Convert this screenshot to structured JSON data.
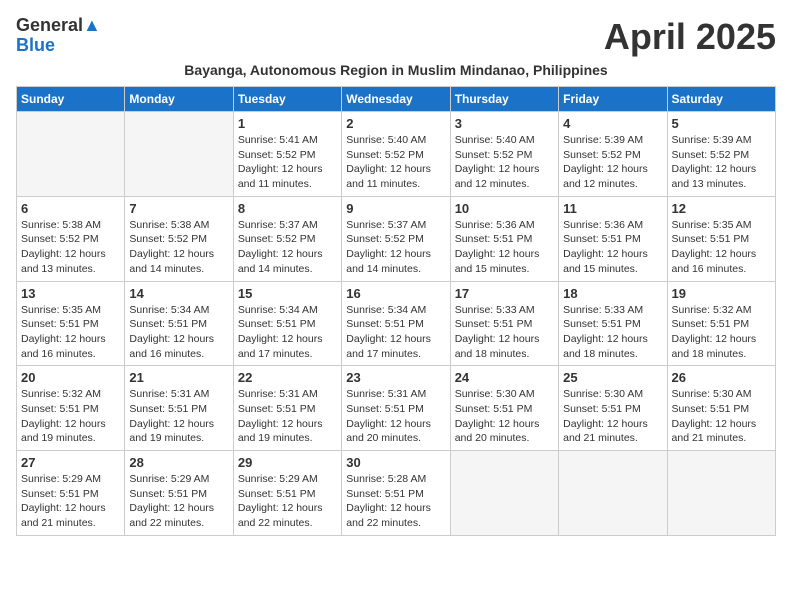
{
  "header": {
    "logo_line1": "General",
    "logo_line2": "Blue",
    "month_title": "April 2025",
    "subtitle": "Bayanga, Autonomous Region in Muslim Mindanao, Philippines"
  },
  "days_of_week": [
    "Sunday",
    "Monday",
    "Tuesday",
    "Wednesday",
    "Thursday",
    "Friday",
    "Saturday"
  ],
  "weeks": [
    [
      {
        "day": "",
        "info": ""
      },
      {
        "day": "",
        "info": ""
      },
      {
        "day": "1",
        "info": "Sunrise: 5:41 AM\nSunset: 5:52 PM\nDaylight: 12 hours and 11 minutes."
      },
      {
        "day": "2",
        "info": "Sunrise: 5:40 AM\nSunset: 5:52 PM\nDaylight: 12 hours and 11 minutes."
      },
      {
        "day": "3",
        "info": "Sunrise: 5:40 AM\nSunset: 5:52 PM\nDaylight: 12 hours and 12 minutes."
      },
      {
        "day": "4",
        "info": "Sunrise: 5:39 AM\nSunset: 5:52 PM\nDaylight: 12 hours and 12 minutes."
      },
      {
        "day": "5",
        "info": "Sunrise: 5:39 AM\nSunset: 5:52 PM\nDaylight: 12 hours and 13 minutes."
      }
    ],
    [
      {
        "day": "6",
        "info": "Sunrise: 5:38 AM\nSunset: 5:52 PM\nDaylight: 12 hours and 13 minutes."
      },
      {
        "day": "7",
        "info": "Sunrise: 5:38 AM\nSunset: 5:52 PM\nDaylight: 12 hours and 14 minutes."
      },
      {
        "day": "8",
        "info": "Sunrise: 5:37 AM\nSunset: 5:52 PM\nDaylight: 12 hours and 14 minutes."
      },
      {
        "day": "9",
        "info": "Sunrise: 5:37 AM\nSunset: 5:52 PM\nDaylight: 12 hours and 14 minutes."
      },
      {
        "day": "10",
        "info": "Sunrise: 5:36 AM\nSunset: 5:51 PM\nDaylight: 12 hours and 15 minutes."
      },
      {
        "day": "11",
        "info": "Sunrise: 5:36 AM\nSunset: 5:51 PM\nDaylight: 12 hours and 15 minutes."
      },
      {
        "day": "12",
        "info": "Sunrise: 5:35 AM\nSunset: 5:51 PM\nDaylight: 12 hours and 16 minutes."
      }
    ],
    [
      {
        "day": "13",
        "info": "Sunrise: 5:35 AM\nSunset: 5:51 PM\nDaylight: 12 hours and 16 minutes."
      },
      {
        "day": "14",
        "info": "Sunrise: 5:34 AM\nSunset: 5:51 PM\nDaylight: 12 hours and 16 minutes."
      },
      {
        "day": "15",
        "info": "Sunrise: 5:34 AM\nSunset: 5:51 PM\nDaylight: 12 hours and 17 minutes."
      },
      {
        "day": "16",
        "info": "Sunrise: 5:34 AM\nSunset: 5:51 PM\nDaylight: 12 hours and 17 minutes."
      },
      {
        "day": "17",
        "info": "Sunrise: 5:33 AM\nSunset: 5:51 PM\nDaylight: 12 hours and 18 minutes."
      },
      {
        "day": "18",
        "info": "Sunrise: 5:33 AM\nSunset: 5:51 PM\nDaylight: 12 hours and 18 minutes."
      },
      {
        "day": "19",
        "info": "Sunrise: 5:32 AM\nSunset: 5:51 PM\nDaylight: 12 hours and 18 minutes."
      }
    ],
    [
      {
        "day": "20",
        "info": "Sunrise: 5:32 AM\nSunset: 5:51 PM\nDaylight: 12 hours and 19 minutes."
      },
      {
        "day": "21",
        "info": "Sunrise: 5:31 AM\nSunset: 5:51 PM\nDaylight: 12 hours and 19 minutes."
      },
      {
        "day": "22",
        "info": "Sunrise: 5:31 AM\nSunset: 5:51 PM\nDaylight: 12 hours and 19 minutes."
      },
      {
        "day": "23",
        "info": "Sunrise: 5:31 AM\nSunset: 5:51 PM\nDaylight: 12 hours and 20 minutes."
      },
      {
        "day": "24",
        "info": "Sunrise: 5:30 AM\nSunset: 5:51 PM\nDaylight: 12 hours and 20 minutes."
      },
      {
        "day": "25",
        "info": "Sunrise: 5:30 AM\nSunset: 5:51 PM\nDaylight: 12 hours and 21 minutes."
      },
      {
        "day": "26",
        "info": "Sunrise: 5:30 AM\nSunset: 5:51 PM\nDaylight: 12 hours and 21 minutes."
      }
    ],
    [
      {
        "day": "27",
        "info": "Sunrise: 5:29 AM\nSunset: 5:51 PM\nDaylight: 12 hours and 21 minutes."
      },
      {
        "day": "28",
        "info": "Sunrise: 5:29 AM\nSunset: 5:51 PM\nDaylight: 12 hours and 22 minutes."
      },
      {
        "day": "29",
        "info": "Sunrise: 5:29 AM\nSunset: 5:51 PM\nDaylight: 12 hours and 22 minutes."
      },
      {
        "day": "30",
        "info": "Sunrise: 5:28 AM\nSunset: 5:51 PM\nDaylight: 12 hours and 22 minutes."
      },
      {
        "day": "",
        "info": ""
      },
      {
        "day": "",
        "info": ""
      },
      {
        "day": "",
        "info": ""
      }
    ]
  ]
}
